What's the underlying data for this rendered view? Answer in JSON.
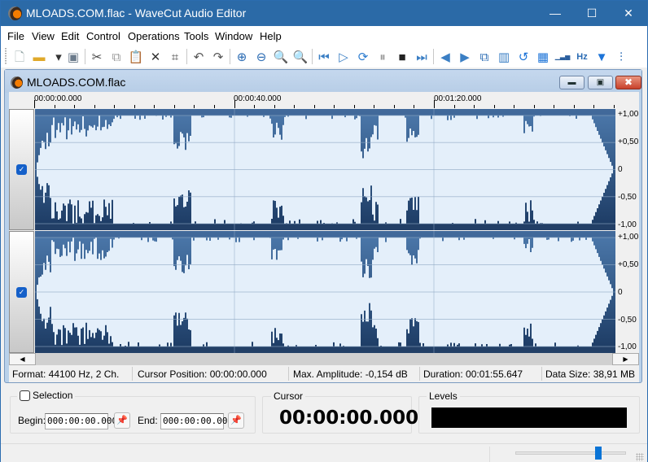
{
  "window": {
    "title": "MLOADS.COM.flac - WaveCut Audio Editor",
    "app_icon": "wavecut-logo-icon",
    "controls": {
      "minimize": "—",
      "maximize": "☐",
      "close": "✕"
    }
  },
  "menu": [
    "File",
    "View",
    "Edit",
    "Control",
    "Operations",
    "Tools",
    "Window",
    "Help"
  ],
  "toolbar": {
    "groups": [
      [
        {
          "name": "new-file-icon",
          "glyph": "🗋",
          "color": "#9aa"
        },
        {
          "name": "open-folder-icon",
          "glyph": "▬",
          "color": "#e0a92a"
        },
        {
          "name": "open-dropdown-icon",
          "glyph": "▾",
          "color": "#333"
        },
        {
          "name": "save-icon",
          "glyph": "▣",
          "color": "#6b7b8b"
        }
      ],
      [
        {
          "name": "cut-icon",
          "glyph": "✂",
          "color": "#444"
        },
        {
          "name": "copy-icon",
          "glyph": "⧉",
          "color": "#999"
        },
        {
          "name": "paste-icon",
          "glyph": "📋",
          "color": "#777"
        },
        {
          "name": "delete-icon",
          "glyph": "✕",
          "color": "#333"
        },
        {
          "name": "crop-icon",
          "glyph": "⌗",
          "color": "#444"
        }
      ],
      [
        {
          "name": "undo-icon",
          "glyph": "↶",
          "color": "#555"
        },
        {
          "name": "redo-icon",
          "glyph": "↷",
          "color": "#555"
        }
      ],
      [
        {
          "name": "zoom-in-icon",
          "glyph": "⊕",
          "color": "#2a6bb3"
        },
        {
          "name": "zoom-out-icon",
          "glyph": "⊖",
          "color": "#2a6bb3"
        },
        {
          "name": "zoom-100-icon",
          "glyph": "🔍",
          "color": "#2a6bb3"
        },
        {
          "name": "zoom-fit-icon",
          "glyph": "🔍",
          "color": "#555"
        }
      ],
      [
        {
          "name": "go-to-start-icon",
          "glyph": "⏮",
          "color": "#3b7fc4"
        },
        {
          "name": "play-icon",
          "glyph": "▷",
          "color": "#3b7fc4"
        },
        {
          "name": "loop-icon",
          "glyph": "⟳",
          "color": "#2f7ed0"
        },
        {
          "name": "pause-icon",
          "glyph": "⏸",
          "color": "#999"
        },
        {
          "name": "stop-icon",
          "glyph": "■",
          "color": "#222"
        },
        {
          "name": "go-to-end-icon",
          "glyph": "⏭",
          "color": "#3b7fc4"
        }
      ],
      [
        {
          "name": "fade-in-icon",
          "glyph": "◀",
          "color": "#3b7fc4"
        },
        {
          "name": "fade-out-icon",
          "glyph": "▶",
          "color": "#3b7fc4"
        },
        {
          "name": "external-link-icon",
          "glyph": "⧉",
          "color": "#2a6bb3"
        },
        {
          "name": "normalize-icon",
          "glyph": "▥",
          "color": "#3b7fc4"
        },
        {
          "name": "reverse-icon",
          "glyph": "↺",
          "color": "#1d74d8"
        },
        {
          "name": "amplify-icon",
          "glyph": "▦",
          "color": "#1d74d8"
        },
        {
          "name": "volume-levels-icon",
          "glyph": "▁▃▅",
          "color": "#2a5f9e"
        },
        {
          "name": "frequency-hz-icon",
          "glyph": "Hz",
          "color": "#2a6bb3"
        },
        {
          "name": "filter-icon",
          "glyph": "▼",
          "color": "#1d74d8"
        },
        {
          "name": "equalizer-icon",
          "glyph": "⫶",
          "color": "#2a6bb3"
        }
      ]
    ]
  },
  "document": {
    "title": "MLOADS.COM.flac",
    "controls": {
      "minimize": "▬",
      "restore": "▣",
      "close": "✖"
    },
    "ruler": {
      "labels": [
        "00:00:00.000",
        "00:00:40.000",
        "00:01:20.000"
      ],
      "total_seconds": 115.647
    },
    "channels": [
      {
        "name": "channel-1",
        "enabled": true,
        "check_glyph": "✓"
      },
      {
        "name": "channel-2",
        "enabled": true,
        "check_glyph": "✓"
      }
    ],
    "amplitude_labels": [
      "+1,00",
      "+0,50",
      "0",
      "-0,50",
      "-1,00"
    ],
    "scroll": {
      "left": "◀",
      "right": "▶"
    }
  },
  "status": {
    "format": "Format: 44100 Hz, 2 Ch.",
    "cursor_position": "Cursor Position: 00:00:00.000",
    "max_amplitude": "Max. Amplitude: -0,154 dB",
    "duration": "Duration: 00:01:55.647",
    "data_size": "Data Size: 38,91 MB"
  },
  "selection": {
    "label": "Selection",
    "checked": false,
    "begin_label": "Begin:",
    "begin_value": "000:00:00.000",
    "end_label": "End:",
    "end_value": "000:00:00.000",
    "pin_glyph": "📌"
  },
  "cursor": {
    "label": "Cursor",
    "value": "00:00:00.000"
  },
  "levels": {
    "label": "Levels"
  },
  "zoom_slider": {
    "value": 0.75
  }
}
